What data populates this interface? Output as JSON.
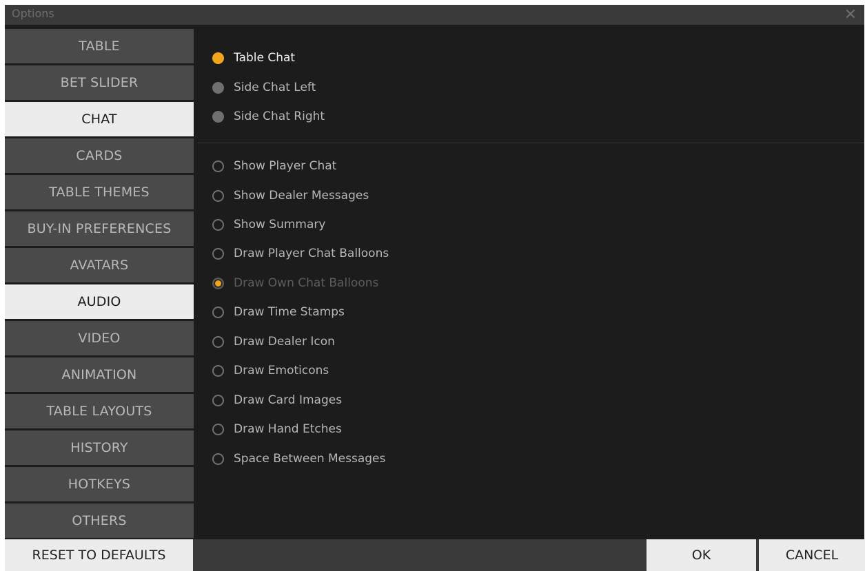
{
  "window": {
    "title": "Options",
    "close_glyph": "✕"
  },
  "sidebar": {
    "items": [
      {
        "label": "TABLE",
        "active": false
      },
      {
        "label": "BET SLIDER",
        "active": false
      },
      {
        "label": "CHAT",
        "active": true
      },
      {
        "label": "CARDS",
        "active": false
      },
      {
        "label": "TABLE THEMES",
        "active": false
      },
      {
        "label": "BUY-IN PREFERENCES",
        "active": false
      },
      {
        "label": "AVATARS",
        "active": false
      },
      {
        "label": "AUDIO",
        "active": true
      },
      {
        "label": "VIDEO",
        "active": false
      },
      {
        "label": "ANIMATION",
        "active": false
      },
      {
        "label": "TABLE LAYOUTS",
        "active": false
      },
      {
        "label": "HISTORY",
        "active": false
      },
      {
        "label": "HOTKEYS",
        "active": false
      },
      {
        "label": "OTHERS",
        "active": false
      }
    ]
  },
  "chat_mode": {
    "options": [
      {
        "label": "Table Chat",
        "selected": true
      },
      {
        "label": "Side Chat Left",
        "selected": false
      },
      {
        "label": "Side Chat Right",
        "selected": false
      }
    ]
  },
  "chat_options": {
    "items": [
      {
        "label": "Show Player Chat",
        "checked": false,
        "disabled": false
      },
      {
        "label": "Show Dealer Messages",
        "checked": false,
        "disabled": false
      },
      {
        "label": "Show Summary",
        "checked": false,
        "disabled": false
      },
      {
        "label": "Draw Player Chat Balloons",
        "checked": false,
        "disabled": false
      },
      {
        "label": "Draw Own Chat Balloons",
        "checked": true,
        "disabled": true
      },
      {
        "label": "Draw Time Stamps",
        "checked": false,
        "disabled": false
      },
      {
        "label": "Draw Dealer Icon",
        "checked": false,
        "disabled": false
      },
      {
        "label": "Draw Emoticons",
        "checked": false,
        "disabled": false
      },
      {
        "label": "Draw Card Images",
        "checked": false,
        "disabled": false
      },
      {
        "label": "Draw Hand Etches",
        "checked": false,
        "disabled": false
      },
      {
        "label": "Space Between Messages",
        "checked": false,
        "disabled": false
      }
    ]
  },
  "footer": {
    "reset_label": "RESET TO DEFAULTS",
    "ok_label": "OK",
    "cancel_label": "CANCEL"
  },
  "colors": {
    "accent": "#f2a41c",
    "nav_bg": "#4a4a4a",
    "nav_active_bg": "#ececec",
    "content_bg": "#1c1c1c"
  },
  "icons": {
    "close": "close-icon",
    "radio_selected": "radio-selected-icon",
    "radio_unselected": "radio-unselected-icon",
    "checkbox_on": "checkbox-checked-icon",
    "checkbox_off": "checkbox-unchecked-icon"
  }
}
